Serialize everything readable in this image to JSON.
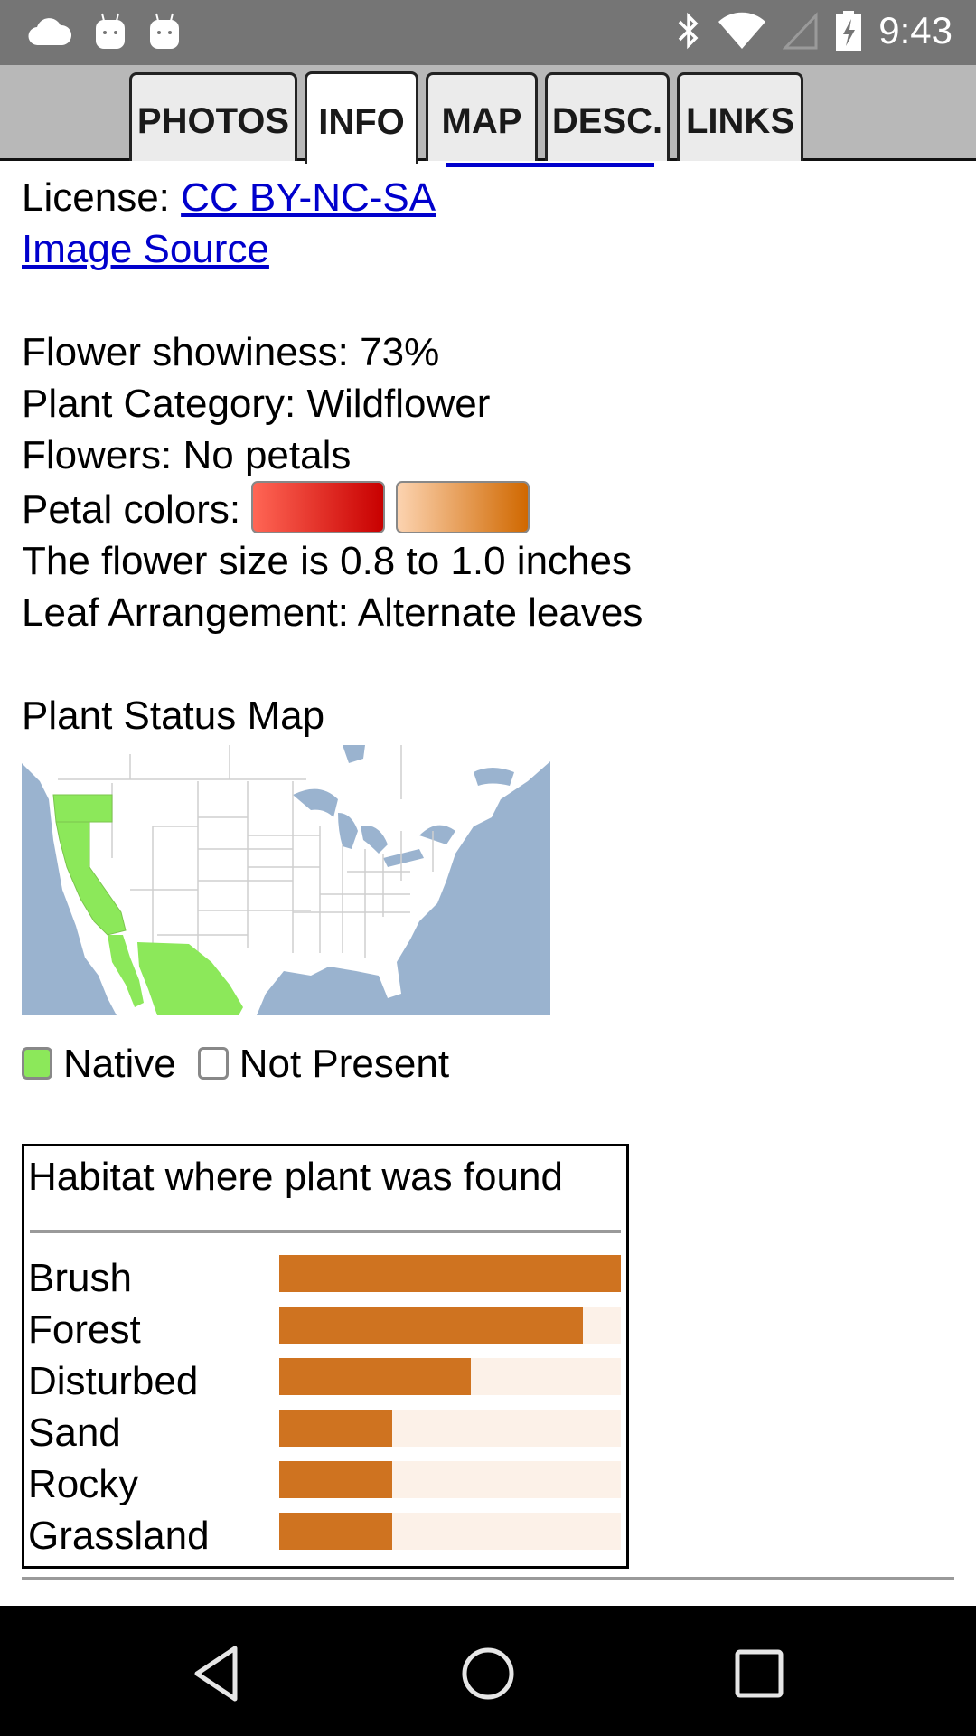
{
  "status_bar": {
    "left_icons": [
      "cloud-icon",
      "android-icon",
      "android-icon"
    ],
    "right_icons": [
      "bluetooth-icon",
      "wifi-icon",
      "cell-signal-icon",
      "battery-charging-icon"
    ],
    "time": "9:43"
  },
  "tabs": [
    {
      "label": "PHOTOS",
      "active": false
    },
    {
      "label": "INFO",
      "active": true
    },
    {
      "label": "MAP",
      "active": false
    },
    {
      "label": "DESC.",
      "active": false
    },
    {
      "label": "LINKS",
      "active": false
    }
  ],
  "info": {
    "license_label": "License: ",
    "license_link": "CC BY-NC-SA",
    "image_source_link": "Image Source",
    "showiness": "Flower showiness: 73%",
    "category": "Plant Category: Wildflower",
    "flowers": "Flowers: No petals",
    "petal_colors_label": "Petal colors:",
    "petal_colors": [
      {
        "name": "red",
        "from": "#ff6655",
        "to": "#c80000"
      },
      {
        "name": "orange",
        "from": "#fcd3b0",
        "to": "#d06800"
      }
    ],
    "flower_size": "The flower size is 0.8 to 1.0 inches",
    "leaf_arrangement": "Leaf Arrangement: Alternate leaves"
  },
  "status_map": {
    "title": "Plant Status Map",
    "native_regions": [
      "Oregon",
      "California",
      "Baja California",
      "Northwestern Mexico"
    ],
    "legend": [
      {
        "label": "Native",
        "color": "#8ce85a"
      },
      {
        "label": "Not Present",
        "color": "#ffffff"
      }
    ],
    "colors": {
      "water": "#9ab3cf",
      "land": "#ffffff",
      "native": "#8ce85a"
    }
  },
  "habitat": {
    "title": "Habitat where plant was found",
    "bar_color": "#cf7320",
    "track_color": "#fcf1e8",
    "items": [
      {
        "label": "Brush",
        "fraction": 1.0
      },
      {
        "label": "Forest",
        "fraction": 0.89
      },
      {
        "label": "Disturbed",
        "fraction": 0.56
      },
      {
        "label": "Sand",
        "fraction": 0.33
      },
      {
        "label": "Rocky",
        "fraction": 0.33
      },
      {
        "label": "Grassland",
        "fraction": 0.33
      }
    ]
  },
  "nav_bar": {
    "buttons": [
      "back-icon",
      "home-icon",
      "recents-icon"
    ]
  }
}
